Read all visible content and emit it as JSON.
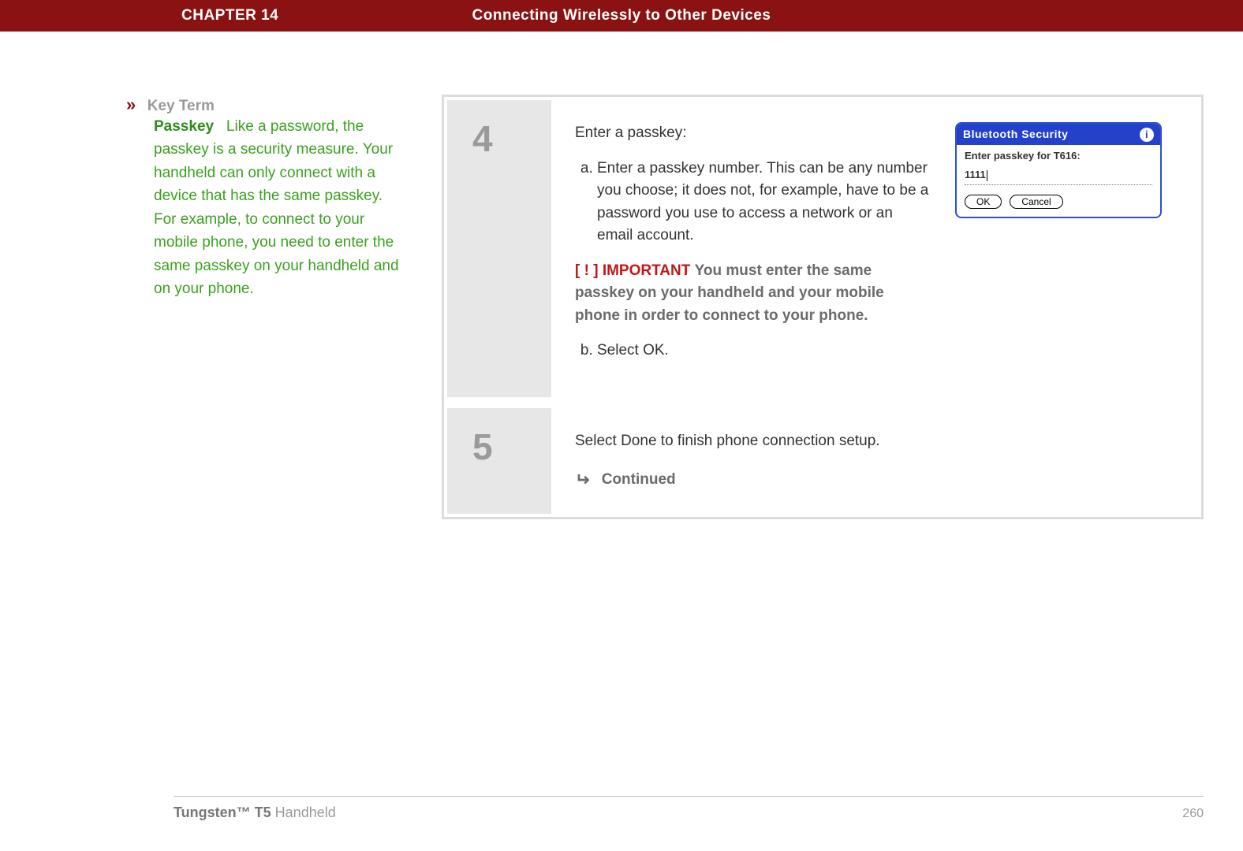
{
  "header": {
    "chapter": "CHAPTER 14",
    "title": "Connecting Wirelessly to Other Devices"
  },
  "sidebar": {
    "keyterm_label": "Key Term",
    "term": "Passkey",
    "definition": "Like a password, the passkey is a security measure. Your handheld can only connect with a device that has the same passkey. For example, to connect to your mobile phone, you need to enter the same passkey on your handheld and on your phone."
  },
  "steps": {
    "four": {
      "num": "4",
      "lead": "Enter a passkey:",
      "a": "Enter a passkey number. This can be any number you choose; it does not, for example, have to be a password you use to access a network or an email account.",
      "important_label": "[ ! ] IMPORTANT",
      "important_text": "You must enter the same passkey on your handheld and your mobile phone in order to connect to your phone.",
      "b": "Select OK."
    },
    "five": {
      "num": "5",
      "text": "Select Done to finish phone connection setup.",
      "continued": "Continued"
    }
  },
  "dialog": {
    "title": "Bluetooth Security",
    "prompt": "Enter passkey for T616:",
    "value": "1111",
    "ok": "OK",
    "cancel": "Cancel"
  },
  "footer": {
    "product_bold": "Tungsten™ T5",
    "product_rest": " Handheld",
    "page": "260"
  }
}
